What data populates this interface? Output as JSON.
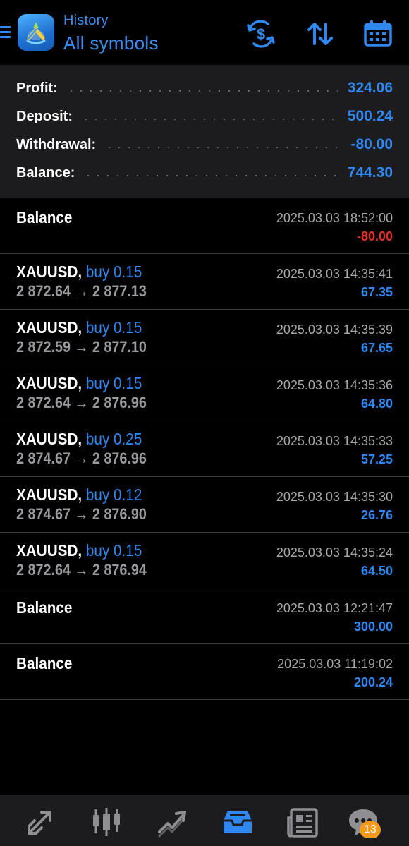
{
  "header": {
    "subtitle": "History",
    "title": "All symbols"
  },
  "summary": [
    {
      "label": "Profit:",
      "value": "324.06"
    },
    {
      "label": "Deposit:",
      "value": "500.24"
    },
    {
      "label": "Withdrawal:",
      "value": "-80.00"
    },
    {
      "label": "Balance:",
      "value": "744.30"
    }
  ],
  "rows": [
    {
      "kind": "balance",
      "title": "Balance",
      "time": "2025.03.03 18:52:00",
      "amount": "-80.00",
      "negative": true
    },
    {
      "kind": "trade",
      "symbol": "XAUUSD,",
      "type": "buy 0.15",
      "prices": "2 872.64 → 2 877.13",
      "time": "2025.03.03 14:35:41",
      "amount": "67.35"
    },
    {
      "kind": "trade",
      "symbol": "XAUUSD,",
      "type": "buy 0.15",
      "prices": "2 872.59 → 2 877.10",
      "time": "2025.03.03 14:35:39",
      "amount": "67.65"
    },
    {
      "kind": "trade",
      "symbol": "XAUUSD,",
      "type": "buy 0.15",
      "prices": "2 872.64 → 2 876.96",
      "time": "2025.03.03 14:35:36",
      "amount": "64.80"
    },
    {
      "kind": "trade",
      "symbol": "XAUUSD,",
      "type": "buy 0.25",
      "prices": "2 874.67 → 2 876.96",
      "time": "2025.03.03 14:35:33",
      "amount": "57.25"
    },
    {
      "kind": "trade",
      "symbol": "XAUUSD,",
      "type": "buy 0.12",
      "prices": "2 874.67 → 2 876.90",
      "time": "2025.03.03 14:35:30",
      "amount": "26.76"
    },
    {
      "kind": "trade",
      "symbol": "XAUUSD,",
      "type": "buy 0.15",
      "prices": "2 872.64 → 2 876.94",
      "time": "2025.03.03 14:35:24",
      "amount": "64.50"
    },
    {
      "kind": "balance",
      "title": "Balance",
      "time": "2025.03.03 12:21:47",
      "amount": "300.00",
      "negative": false
    },
    {
      "kind": "balance",
      "title": "Balance",
      "time": "2025.03.03 11:19:02",
      "amount": "200.24",
      "negative": false
    }
  ],
  "nav": {
    "items": [
      "quotes-icon",
      "chart-icon",
      "trade-icon",
      "history-icon",
      "news-icon",
      "chat-icon"
    ],
    "active": "history-icon",
    "chat_badge": "13"
  },
  "colors": {
    "accent": "#2f87f0",
    "negative": "#e0312b",
    "badge": "#f29a1a",
    "panel": "#1c1c1e"
  }
}
